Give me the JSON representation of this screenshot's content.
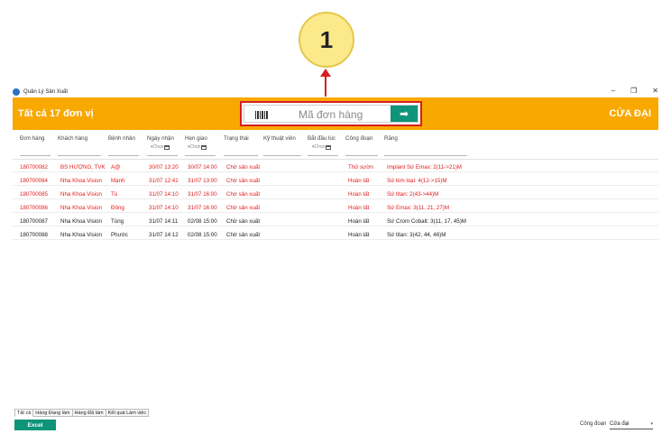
{
  "annotation": {
    "number": "1"
  },
  "window": {
    "title": "Quản Lý Sản Xuất",
    "controls": {
      "minimize": "–",
      "restore": "❐",
      "close": "✕"
    }
  },
  "header": {
    "summary": "Tất cả  17  đơn vị",
    "location": "CỬA ĐẠI",
    "search_placeholder": "Mã đơn hàng",
    "go_glyph": "➡"
  },
  "columns": {
    "order": "Đơn hàng",
    "customer": "Khách hàng",
    "patient": "Bệnh nhân",
    "received": "Ngày nhận",
    "due": "Hẹn giao",
    "status": "Trạng thái",
    "technician": "Kỹ thuật viên",
    "started": "Bắt đầu lúc",
    "stage": "Công đoạn",
    "teeth": "Răng"
  },
  "filters": {
    "placeholder": "▾Chọn"
  },
  "rows": [
    {
      "order": "180700082",
      "customer": "BS HƯƠNG, TVK",
      "patient": "A@",
      "received": "30/07 13:20",
      "due": "30/07 14:00",
      "status": "Chờ sản xuất",
      "technician": "",
      "started": "",
      "stage": "Thử sườn",
      "teeth": "Implant Sứ Emax: 2(11->21)M",
      "tone": "red"
    },
    {
      "order": "180700084",
      "customer": "Nha Khoa Vision",
      "patient": "Mạnh",
      "received": "31/07 12:41",
      "due": "31/07 13:00",
      "status": "Chờ sản xuất",
      "technician": "",
      "started": "",
      "stage": "Hoàn tất",
      "teeth": "Sứ kim loại: 4(12->15)M",
      "tone": "red"
    },
    {
      "order": "180700085",
      "customer": "Nha Khoa Vision",
      "patient": "Tú",
      "received": "31/07 14:10",
      "due": "31/07 16:00",
      "status": "Chờ sản xuất",
      "technician": "",
      "started": "",
      "stage": "Hoàn tất",
      "teeth": "Sứ titan: 2(43->44)M",
      "tone": "red"
    },
    {
      "order": "180700086",
      "customer": "Nha Khoa Vision",
      "patient": "Đông",
      "received": "31/07 14:10",
      "due": "31/07 16:00",
      "status": "Chờ sản xuất",
      "technician": "",
      "started": "",
      "stage": "Hoàn tất",
      "teeth": "Sứ Emax: 3(11, 21, 27)M",
      "tone": "red"
    },
    {
      "order": "180700087",
      "customer": "Nha Khoa Vision",
      "patient": "Tùng",
      "received": "31/07 14:11",
      "due": "02/08 15:00",
      "status": "Chờ sản xuất",
      "technician": "",
      "started": "",
      "stage": "Hoàn tất",
      "teeth": "Sứ Crom Cobalt: 3(11, 17, 45)M",
      "tone": "black"
    },
    {
      "order": "180700088",
      "customer": "Nha Khoa Vision",
      "patient": "Phước",
      "received": "31/07 14:12",
      "due": "02/08 15:00",
      "status": "Chờ sản xuất",
      "technician": "",
      "started": "",
      "stage": "Hoàn tất",
      "teeth": "Sứ titan: 3(42, 44, 46)M",
      "tone": "black"
    }
  ],
  "tabs": [
    "Tất cả",
    "Hàng Đang làm",
    "Hàng Đã làm",
    "Kết quả Làm việc"
  ],
  "footer": {
    "excel_label": "Excel",
    "stage_label": "Công đoạn",
    "stage_value": "Cửa đại",
    "dropdown_glyph": "▾"
  },
  "colors": {
    "header": "#f9a800",
    "accent": "#0e9479",
    "highlight": "#d61f1f",
    "row_alert": "#e01c1c"
  }
}
